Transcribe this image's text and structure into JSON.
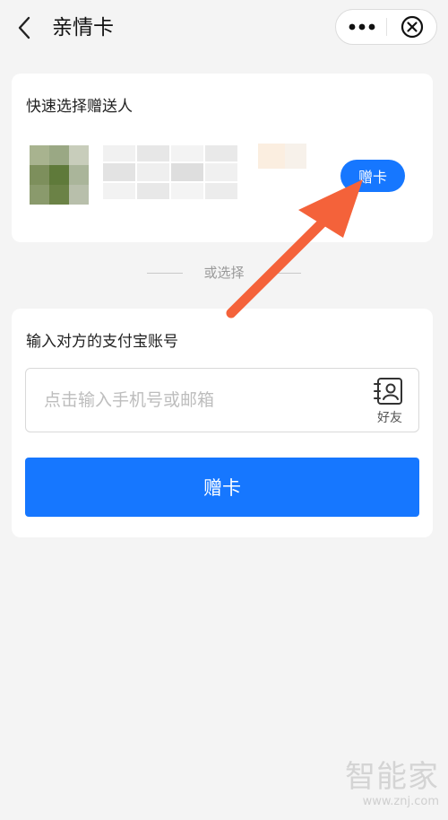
{
  "nav": {
    "title": "亲情卡",
    "back_icon": "chevron-left-icon",
    "more_icon": "more-dots-icon",
    "close_icon": "close-circle-icon"
  },
  "quick_select": {
    "title": "快速选择赠送人",
    "gift_button_label": "赠卡"
  },
  "divider": {
    "text": "或选择"
  },
  "account_entry": {
    "title": "输入对方的支付宝账号",
    "input_value": "",
    "input_placeholder": "点击输入手机号或邮箱",
    "friend_label": "好友",
    "friend_icon": "contact-book-icon",
    "submit_label": "赠卡"
  },
  "annotation": {
    "arrow_color": "#f4623a"
  },
  "watermark": {
    "logo_text": "智能家",
    "url_text": "www.znj.com"
  },
  "colors": {
    "accent": "#1677ff",
    "background": "#f4f4f4",
    "card": "#ffffff"
  }
}
